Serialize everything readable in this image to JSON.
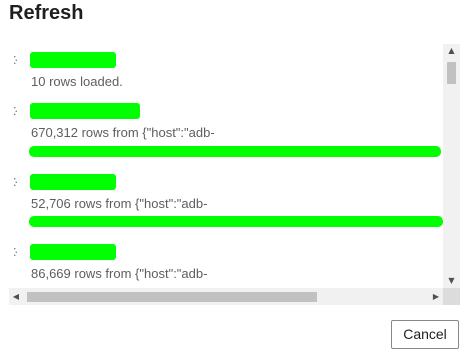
{
  "dialog": {
    "title": "Refresh",
    "items": [
      {
        "status_text": "10 rows loaded."
      },
      {
        "status_text": "670,312 rows from {\"host\":\"adb-"
      },
      {
        "status_text": "52,706 rows from {\"host\":\"adb-"
      },
      {
        "status_text": "86,669 rows from {\"host\":\"adb-"
      }
    ],
    "cancel_label": "Cancel"
  },
  "icons": {
    "spinner": "spinner-icon",
    "scroll_up": "▲",
    "scroll_down": "▼",
    "scroll_left": "◀",
    "scroll_right": "▶"
  },
  "colors": {
    "redaction": "#00ff00",
    "button_border": "#8a8886",
    "scrollbar_track": "#f1f1f1",
    "scrollbar_thumb": "#c1c1c1"
  }
}
